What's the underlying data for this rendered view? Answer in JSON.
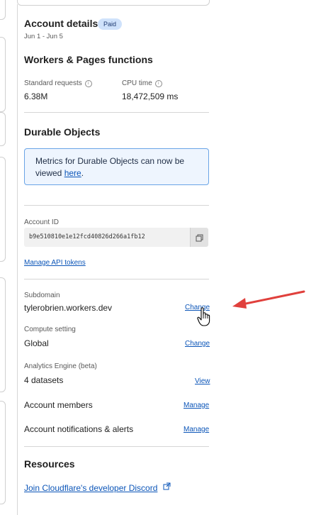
{
  "account": {
    "title": "Account details",
    "badge": "Paid",
    "date_range": "Jun 1 - Jun 5"
  },
  "workers": {
    "title": "Workers & Pages functions",
    "standard_requests_label": "Standard requests",
    "standard_requests_value": "6.38M",
    "cpu_time_label": "CPU time",
    "cpu_time_value": "18,472,509 ms"
  },
  "durable": {
    "title": "Durable Objects",
    "notice_text": "Metrics for Durable Objects can now be viewed",
    "notice_link": "here",
    "notice_end": "."
  },
  "account_id": {
    "label": "Account ID",
    "value": "b9e510810e1e12fcd40826d266a1fb12",
    "manage_tokens": "Manage API tokens"
  },
  "settings": {
    "subdomain_label": "Subdomain",
    "subdomain_value": "tylerobrien.workers.dev",
    "subdomain_action": "Change",
    "compute_label": "Compute setting",
    "compute_value": "Global",
    "compute_action": "Change",
    "analytics_label": "Analytics Engine (beta)",
    "analytics_value": "4 datasets",
    "analytics_action": "View",
    "members_label": "Account members",
    "members_action": "Manage",
    "notifications_label": "Account notifications & alerts",
    "notifications_action": "Manage"
  },
  "resources": {
    "title": "Resources",
    "discord_link": "Join Cloudflare's developer Discord"
  },
  "icons": {
    "info": "info-icon",
    "copy": "copy-icon",
    "external": "external-link-icon",
    "cursor": "hand-cursor-icon",
    "arrow": "red-arrow-annotation"
  },
  "colors": {
    "link": "#0b55b8",
    "badge_bg": "#cfe2fb",
    "notice_border": "#6aa4e6",
    "notice_bg": "#eef5fe",
    "arrow": "#e0403c"
  }
}
